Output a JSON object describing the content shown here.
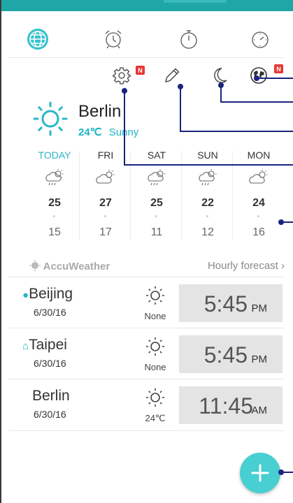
{
  "tabs": [
    {
      "icon": "globe-icon",
      "active": true
    },
    {
      "icon": "alarm-clock-icon",
      "active": false
    },
    {
      "icon": "stopwatch-icon",
      "active": false
    },
    {
      "icon": "timer-icon",
      "active": false
    }
  ],
  "actions": [
    {
      "icon": "gear-icon",
      "badge": "N"
    },
    {
      "icon": "pencil-icon"
    },
    {
      "icon": "moon-icon"
    },
    {
      "icon": "world-map-icon",
      "badge": "N"
    }
  ],
  "current": {
    "city": "Berlin",
    "temp": "24℃",
    "condition": "Sunny",
    "icon": "sun-icon"
  },
  "forecast": [
    {
      "day": "TODAY",
      "high": "25",
      "low": "15",
      "icon": "cloud-rain-sun-icon"
    },
    {
      "day": "FRI",
      "high": "27",
      "low": "17",
      "icon": "cloud-sun-icon"
    },
    {
      "day": "SAT",
      "high": "25",
      "low": "11",
      "icon": "cloud-rain-sun-icon"
    },
    {
      "day": "SUN",
      "high": "22",
      "low": "12",
      "icon": "cloud-rain-sun-icon"
    },
    {
      "day": "MON",
      "high": "24",
      "low": "16",
      "icon": "cloud-sun-icon"
    }
  ],
  "attribution": "AccuWeather",
  "hourly_label": "Hourly forecast",
  "cities": [
    {
      "name": "Beijing",
      "date": "6/30/16",
      "weather": "None",
      "time": "5:45",
      "ampm": "PM",
      "marker": "location-pin-icon"
    },
    {
      "name": "Taipei",
      "date": "6/30/16",
      "weather": "None",
      "time": "5:45",
      "ampm": "PM",
      "marker": "home-icon"
    },
    {
      "name": "Berlin",
      "date": "6/30/16",
      "weather": "24℃",
      "time": "11:45",
      "ampm": "AM",
      "marker": ""
    }
  ],
  "fab": {
    "icon": "plus-icon"
  },
  "colors": {
    "accent": "#1cb5c4",
    "badge": "#e53935",
    "fab": "#47cfd2",
    "callout": "#1a237e"
  }
}
